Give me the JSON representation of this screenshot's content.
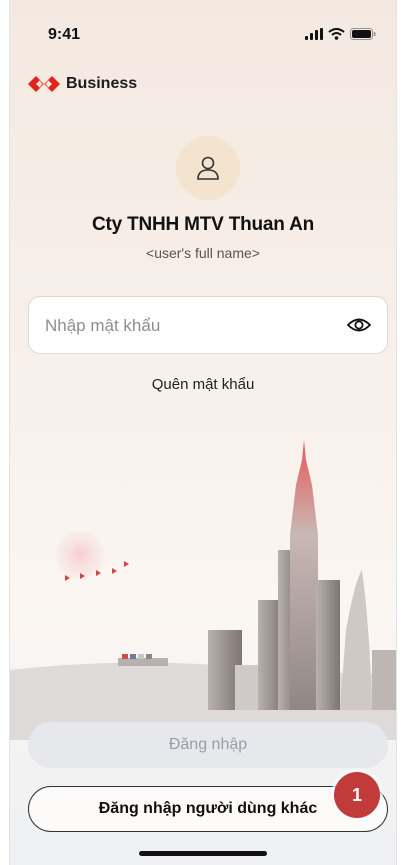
{
  "status_bar": {
    "time": "9:41"
  },
  "brand": {
    "label": "Business",
    "color": "#e2231a"
  },
  "account": {
    "company": "Cty TNHH MTV Thuan An",
    "full_name": "<user's full name>"
  },
  "password": {
    "placeholder": "Nhập mật khẩu",
    "value": ""
  },
  "forgot_link": "Quên mật khẩu",
  "buttons": {
    "login": "Đăng nhập",
    "other_user": "Đăng nhập người dùng khác"
  },
  "badge": "1",
  "icons": [
    "signal-icon",
    "wifi-icon",
    "battery-icon",
    "brand-logo-icon",
    "user-icon",
    "eye-icon"
  ],
  "colors": {
    "accent": "#c23b3b",
    "disabled_bg": "#e6e8ec",
    "disabled_text": "#9a9ea6"
  }
}
